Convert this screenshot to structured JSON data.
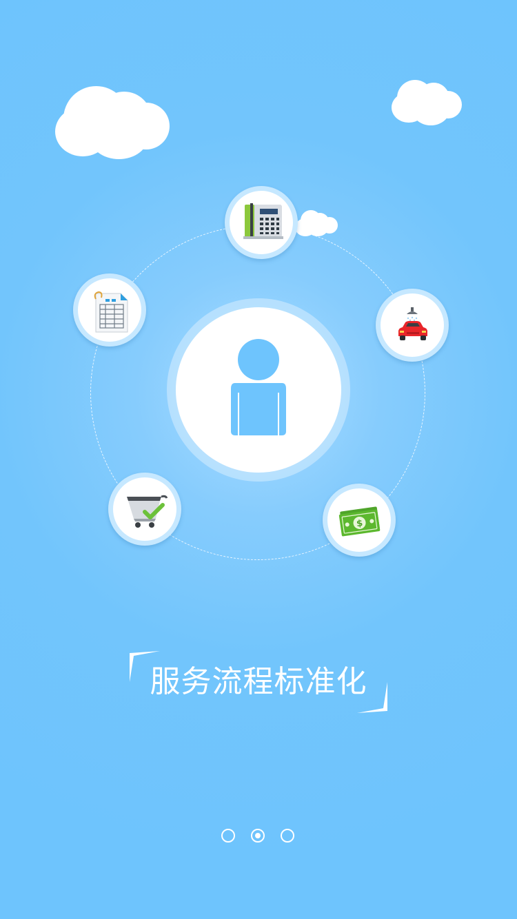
{
  "slide": {
    "title": "服务流程标准化"
  },
  "icons": {
    "center": "person-icon",
    "top": "desk-phone-icon",
    "left": "spreadsheet-document-icon",
    "right": "car-wash-icon",
    "bottom_left": "cart-checkmark-icon",
    "bottom_right": "money-bill-icon"
  },
  "pager": {
    "total": 3,
    "active_index": 1
  },
  "colors": {
    "background": "#6ec4fd",
    "accent_blue": "#6ec4fd",
    "white": "#ffffff",
    "money_green": "#5cb82e",
    "car_red": "#e8262a"
  }
}
